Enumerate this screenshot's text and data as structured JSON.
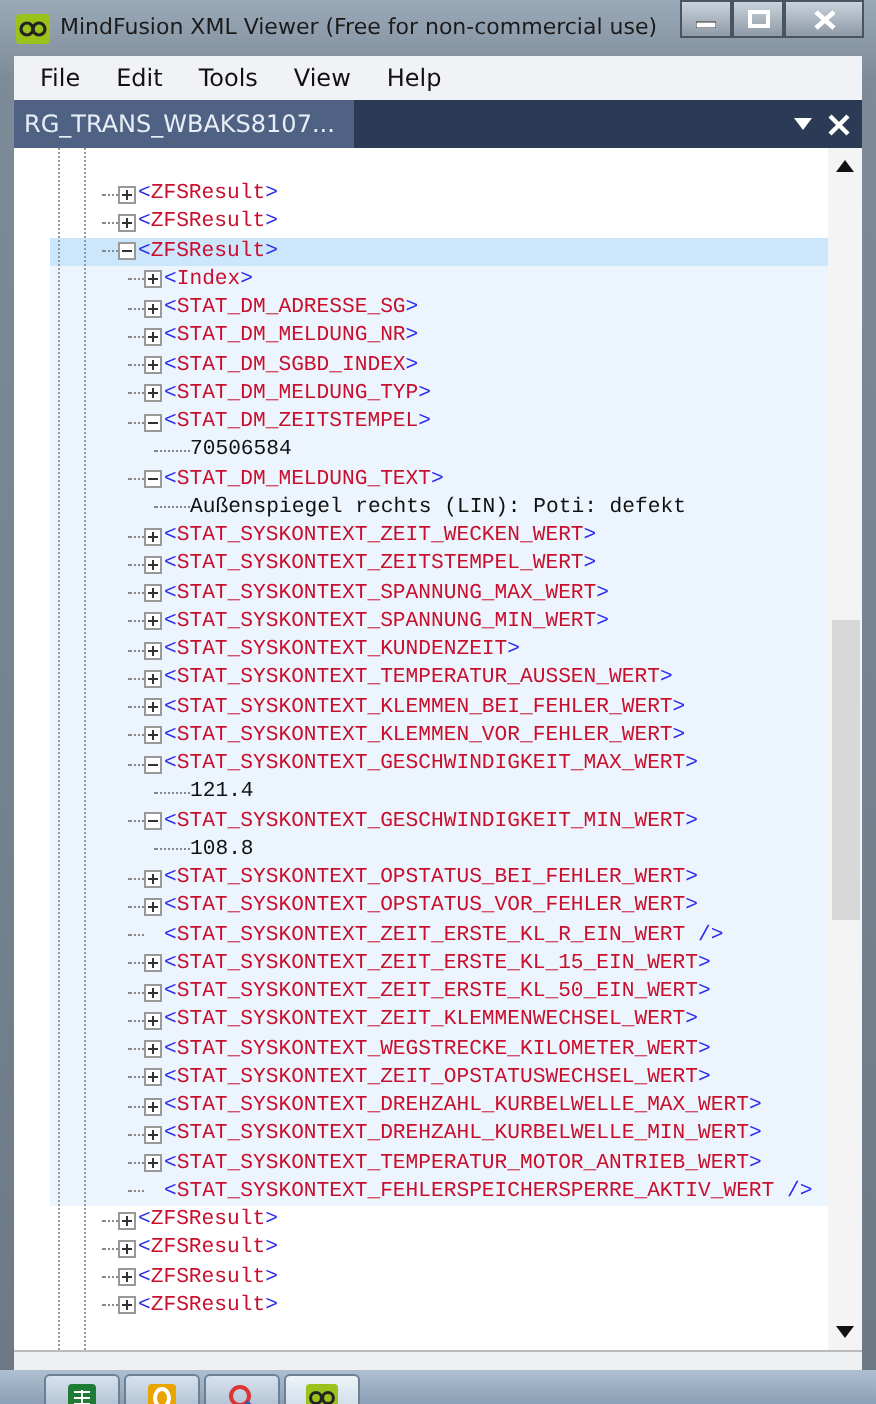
{
  "window": {
    "title": "MindFusion XML Viewer (Free for non-commercial use)"
  },
  "menu": [
    "File",
    "Edit",
    "Tools",
    "View",
    "Help"
  ],
  "document_tab": {
    "label": "RG_TRANS_WBAKS8107...",
    "selected": true
  },
  "tree": [
    {
      "kind": "element",
      "lt": "<",
      "name": "ZFSResult",
      "gt": ">",
      "expanded": false,
      "selected": false
    },
    {
      "kind": "element",
      "lt": "<",
      "name": "ZFSResult",
      "gt": ">",
      "expanded": false,
      "selected": false
    },
    {
      "kind": "element",
      "lt": "<",
      "name": "ZFSResult",
      "gt": ">",
      "expanded": true,
      "selected": true,
      "children": [
        {
          "kind": "element",
          "lt": "<",
          "name": "Index",
          "gt": ">",
          "expanded": false,
          "selected": false
        },
        {
          "kind": "element",
          "lt": "<",
          "name": "STAT_DM_ADRESSE_SG",
          "gt": ">",
          "expanded": false,
          "selected": false
        },
        {
          "kind": "element",
          "lt": "<",
          "name": "STAT_DM_MELDUNG_NR",
          "gt": ">",
          "expanded": false,
          "selected": false
        },
        {
          "kind": "element",
          "lt": "<",
          "name": "STAT_DM_SGBD_INDEX",
          "gt": ">",
          "expanded": false,
          "selected": false
        },
        {
          "kind": "element",
          "lt": "<",
          "name": "STAT_DM_MELDUNG_TYP",
          "gt": ">",
          "expanded": false,
          "selected": false
        },
        {
          "kind": "element",
          "lt": "<",
          "name": "STAT_DM_ZEITSTEMPEL",
          "gt": ">",
          "expanded": true,
          "selected": false,
          "children": [
            {
              "kind": "text",
              "text": "70506584"
            }
          ]
        },
        {
          "kind": "element",
          "lt": "<",
          "name": "STAT_DM_MELDUNG_TEXT",
          "gt": ">",
          "expanded": true,
          "selected": false,
          "children": [
            {
              "kind": "text",
              "text": "Außenspiegel rechts (LIN): Poti: defekt"
            }
          ]
        },
        {
          "kind": "element",
          "lt": "<",
          "name": "STAT_SYSKONTEXT_ZEIT_WECKEN_WERT",
          "gt": ">",
          "expanded": false,
          "selected": false
        },
        {
          "kind": "element",
          "lt": "<",
          "name": "STAT_SYSKONTEXT_ZEITSTEMPEL_WERT",
          "gt": ">",
          "expanded": false,
          "selected": false
        },
        {
          "kind": "element",
          "lt": "<",
          "name": "STAT_SYSKONTEXT_SPANNUNG_MAX_WERT",
          "gt": ">",
          "expanded": false,
          "selected": false
        },
        {
          "kind": "element",
          "lt": "<",
          "name": "STAT_SYSKONTEXT_SPANNUNG_MIN_WERT",
          "gt": ">",
          "expanded": false,
          "selected": false
        },
        {
          "kind": "element",
          "lt": "<",
          "name": "STAT_SYSKONTEXT_KUNDENZEIT",
          "gt": ">",
          "expanded": false,
          "selected": false
        },
        {
          "kind": "element",
          "lt": "<",
          "name": "STAT_SYSKONTEXT_TEMPERATUR_AUSSEN_WERT",
          "gt": ">",
          "expanded": false,
          "selected": false
        },
        {
          "kind": "element",
          "lt": "<",
          "name": "STAT_SYSKONTEXT_KLEMMEN_BEI_FEHLER_WERT",
          "gt": ">",
          "expanded": false,
          "selected": false
        },
        {
          "kind": "element",
          "lt": "<",
          "name": "STAT_SYSKONTEXT_KLEMMEN_VOR_FEHLER_WERT",
          "gt": ">",
          "expanded": false,
          "selected": false
        },
        {
          "kind": "element",
          "lt": "<",
          "name": "STAT_SYSKONTEXT_GESCHWINDIGKEIT_MAX_WERT",
          "gt": ">",
          "expanded": true,
          "selected": false,
          "children": [
            {
              "kind": "text",
              "text": "121.4"
            }
          ]
        },
        {
          "kind": "element",
          "lt": "<",
          "name": "STAT_SYSKONTEXT_GESCHWINDIGKEIT_MIN_WERT",
          "gt": ">",
          "expanded": true,
          "selected": false,
          "children": [
            {
              "kind": "text",
              "text": "108.8"
            }
          ]
        },
        {
          "kind": "element",
          "lt": "<",
          "name": "STAT_SYSKONTEXT_OPSTATUS_BEI_FEHLER_WERT",
          "gt": ">",
          "expanded": false,
          "selected": false
        },
        {
          "kind": "element",
          "lt": "<",
          "name": "STAT_SYSKONTEXT_OPSTATUS_VOR_FEHLER_WERT",
          "gt": ">",
          "expanded": false,
          "selected": false
        },
        {
          "kind": "empty",
          "lt": "<",
          "name": "STAT_SYSKONTEXT_ZEIT_ERSTE_KL_R_EIN_WERT",
          "gt": " />"
        },
        {
          "kind": "element",
          "lt": "<",
          "name": "STAT_SYSKONTEXT_ZEIT_ERSTE_KL_15_EIN_WERT",
          "gt": ">",
          "expanded": false,
          "selected": false
        },
        {
          "kind": "element",
          "lt": "<",
          "name": "STAT_SYSKONTEXT_ZEIT_ERSTE_KL_50_EIN_WERT",
          "gt": ">",
          "expanded": false,
          "selected": false
        },
        {
          "kind": "element",
          "lt": "<",
          "name": "STAT_SYSKONTEXT_ZEIT_KLEMMENWECHSEL_WERT",
          "gt": ">",
          "expanded": false,
          "selected": false
        },
        {
          "kind": "element",
          "lt": "<",
          "name": "STAT_SYSKONTEXT_WEGSTRECKE_KILOMETER_WERT",
          "gt": ">",
          "expanded": false,
          "selected": false
        },
        {
          "kind": "element",
          "lt": "<",
          "name": "STAT_SYSKONTEXT_ZEIT_OPSTATUSWECHSEL_WERT",
          "gt": ">",
          "expanded": false,
          "selected": false
        },
        {
          "kind": "element",
          "lt": "<",
          "name": "STAT_SYSKONTEXT_DREHZAHL_KURBELWELLE_MAX_WERT",
          "gt": ">",
          "expanded": false,
          "selected": false
        },
        {
          "kind": "element",
          "lt": "<",
          "name": "STAT_SYSKONTEXT_DREHZAHL_KURBELWELLE_MIN_WERT",
          "gt": ">",
          "expanded": false,
          "selected": false
        },
        {
          "kind": "element",
          "lt": "<",
          "name": "STAT_SYSKONTEXT_TEMPERATUR_MOTOR_ANTRIEB_WERT",
          "gt": ">",
          "expanded": false,
          "selected": false
        },
        {
          "kind": "empty",
          "lt": "<",
          "name": "STAT_SYSKONTEXT_FEHLERSPEICHERSPERRE_AKTIV_WERT",
          "gt": " />"
        }
      ]
    },
    {
      "kind": "element",
      "lt": "<",
      "name": "ZFSResult",
      "gt": ">",
      "expanded": false,
      "selected": false
    },
    {
      "kind": "element",
      "lt": "<",
      "name": "ZFSResult",
      "gt": ">",
      "expanded": false,
      "selected": false
    },
    {
      "kind": "element",
      "lt": "<",
      "name": "ZFSResult",
      "gt": ">",
      "expanded": false,
      "selected": false
    },
    {
      "kind": "element",
      "lt": "<",
      "name": "ZFSResult",
      "gt": ">",
      "expanded": false,
      "selected": false
    }
  ],
  "taskbar": [
    {
      "kind": "spreadsheet",
      "selected": false
    },
    {
      "kind": "mail",
      "selected": false
    },
    {
      "kind": "tool",
      "selected": false
    },
    {
      "kind": "app",
      "selected": true
    }
  ]
}
